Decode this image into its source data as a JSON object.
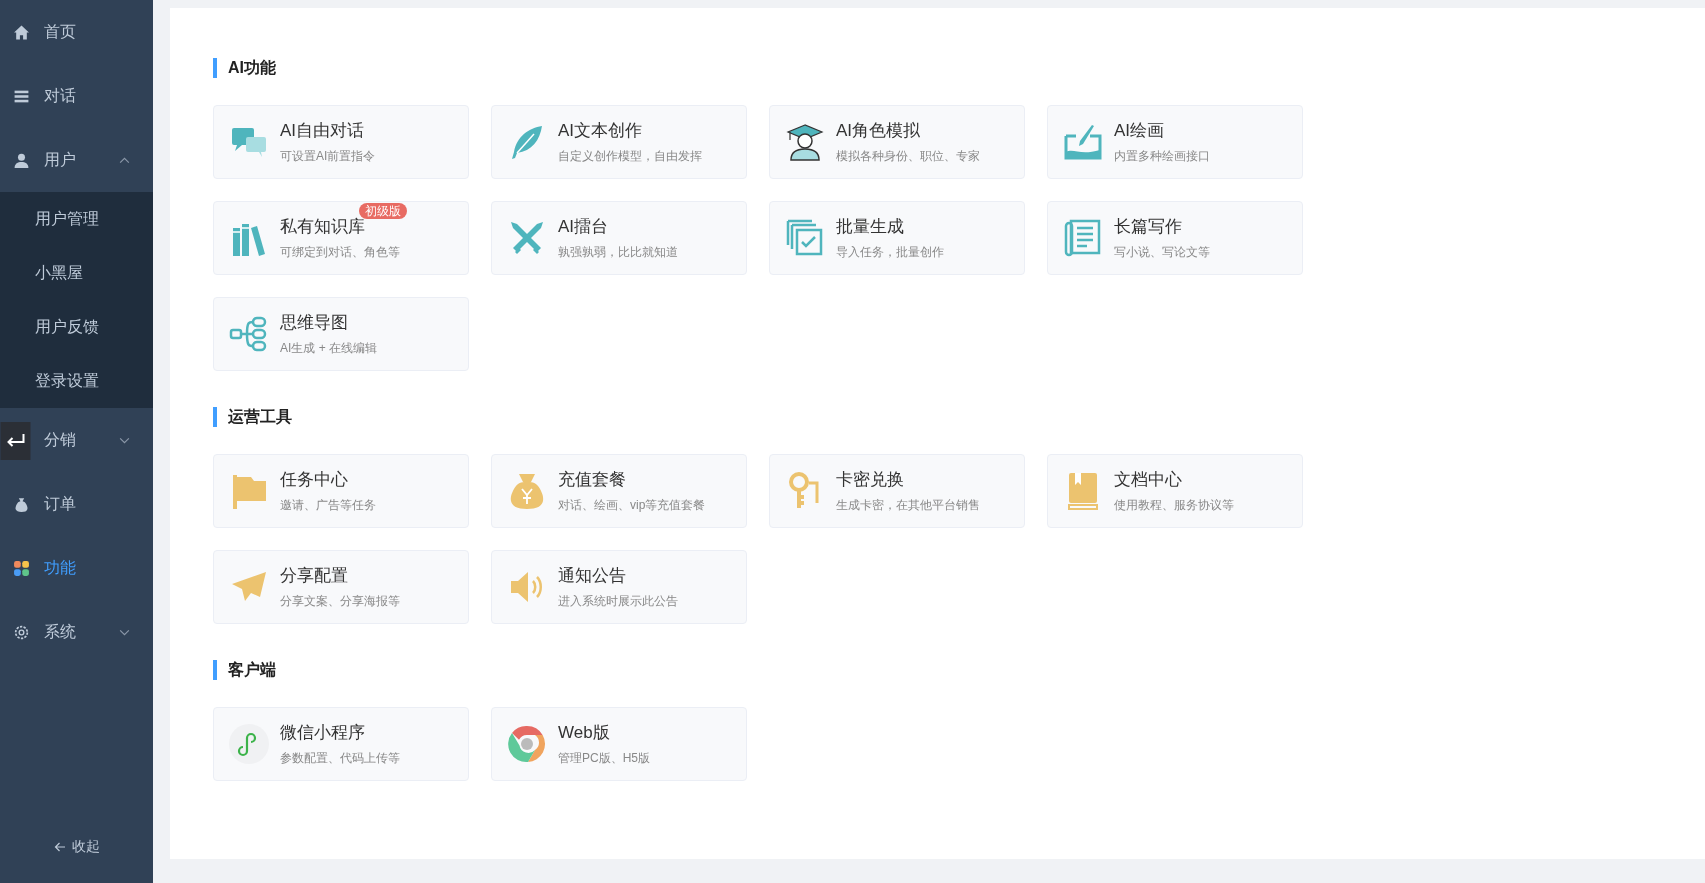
{
  "sidebar": {
    "items": [
      {
        "kind": "link",
        "label": "首页",
        "selected": false
      },
      {
        "kind": "link",
        "label": "对话",
        "selected": false
      },
      {
        "kind": "group",
        "label": "用户",
        "selected": false,
        "expanded": true,
        "children": [
          {
            "label": "用户管理",
            "selected": false
          },
          {
            "label": "小黑屋",
            "selected": false
          },
          {
            "label": "用户反馈",
            "selected": false
          },
          {
            "label": "登录设置",
            "selected": false
          }
        ]
      },
      {
        "kind": "group",
        "label": "分销",
        "selected": false,
        "expanded": false
      },
      {
        "kind": "link",
        "label": "订单",
        "selected": false
      },
      {
        "kind": "link",
        "label": "功能",
        "selected": true
      },
      {
        "kind": "group",
        "label": "系统",
        "selected": false,
        "expanded": false
      }
    ],
    "collapse": "收起"
  },
  "sections": [
    {
      "title": "AI功能",
      "cards": [
        {
          "title": "AI自由对话",
          "desc": "可设置AI前置指令"
        },
        {
          "title": "AI文本创作",
          "desc": "自定义创作模型，自由发挥"
        },
        {
          "title": "AI角色模拟",
          "desc": "模拟各种身份、职位、专家"
        },
        {
          "title": "AI绘画",
          "desc": "内置多种绘画接口"
        },
        {
          "title": "私有知识库",
          "desc": "可绑定到对话、角色等",
          "badge": "初级版"
        },
        {
          "title": "AI擂台",
          "desc": "孰强孰弱，比比就知道"
        },
        {
          "title": "批量生成",
          "desc": "导入任务，批量创作"
        },
        {
          "title": "长篇写作",
          "desc": "写小说、写论文等"
        },
        {
          "title": "思维导图",
          "desc": "AI生成 + 在线编辑"
        }
      ]
    },
    {
      "title": "运营工具",
      "cards": [
        {
          "title": "任务中心",
          "desc": "邀请、广告等任务"
        },
        {
          "title": "充值套餐",
          "desc": "对话、绘画、vip等充值套餐"
        },
        {
          "title": "卡密兑换",
          "desc": "生成卡密，在其他平台销售"
        },
        {
          "title": "文档中心",
          "desc": "使用教程、服务协议等"
        },
        {
          "title": "分享配置",
          "desc": "分享文案、分享海报等"
        },
        {
          "title": "通知公告",
          "desc": "进入系统时展示此公告"
        }
      ]
    },
    {
      "title": "客户端",
      "cards": [
        {
          "title": "微信小程序",
          "desc": "参数配置、代码上传等"
        },
        {
          "title": "Web版",
          "desc": "管理PC版、H5版"
        }
      ]
    }
  ]
}
